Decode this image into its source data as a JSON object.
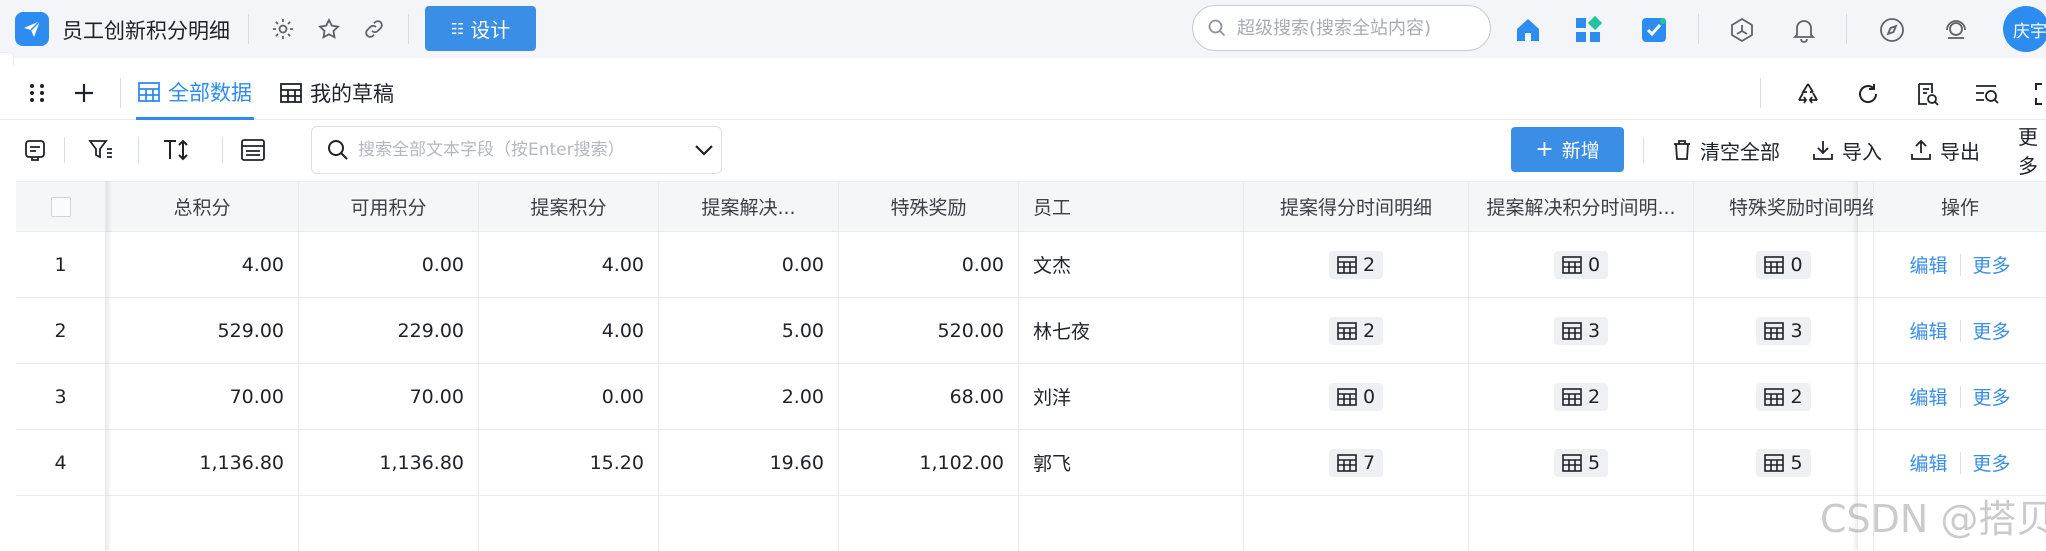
{
  "app": {
    "title": "员工创新积分明细",
    "design_label": "设计",
    "user_name": "庆宇"
  },
  "search": {
    "placeholder": "超级搜索(搜索全站内容)"
  },
  "tabs": [
    {
      "label": "全部数据",
      "active": true
    },
    {
      "label": "我的草稿",
      "active": false
    }
  ],
  "toolbar": {
    "filter_placeholder": "搜索全部文本字段（按Enter搜索）",
    "add_label": "新增",
    "clear_label": "清空全部",
    "import_label": "导入",
    "export_label": "导出",
    "more_label": "更多"
  },
  "table": {
    "columns": [
      "总积分",
      "可用积分",
      "提案积分",
      "提案解决...",
      "特殊奖励",
      "员工",
      "提案得分时间明细",
      "提案解决积分时间明...",
      "特殊奖励时间明细",
      "操作"
    ],
    "rows": [
      {
        "index": "1",
        "total": "4.00",
        "available": "0.00",
        "proposal": "4.00",
        "solution": "0.00",
        "special": "0.00",
        "employee": "文杰",
        "d1": "2",
        "d2": "0",
        "d3": "0"
      },
      {
        "index": "2",
        "total": "529.00",
        "available": "229.00",
        "proposal": "4.00",
        "solution": "5.00",
        "special": "520.00",
        "employee": "林七夜",
        "d1": "2",
        "d2": "3",
        "d3": "3"
      },
      {
        "index": "3",
        "total": "70.00",
        "available": "70.00",
        "proposal": "0.00",
        "solution": "2.00",
        "special": "68.00",
        "employee": "刘洋",
        "d1": "0",
        "d2": "2",
        "d3": "2"
      },
      {
        "index": "4",
        "total": "1,136.80",
        "available": "1,136.80",
        "proposal": "15.20",
        "solution": "19.60",
        "special": "1,102.00",
        "employee": "郭飞",
        "d1": "7",
        "d2": "5",
        "d3": "5"
      }
    ],
    "edit_label": "编辑",
    "more_label": "更多"
  },
  "watermark": "CSDN @搭贝",
  "colors": {
    "accent": "#3a8ee6",
    "header_bg": "#f5f6f7"
  }
}
